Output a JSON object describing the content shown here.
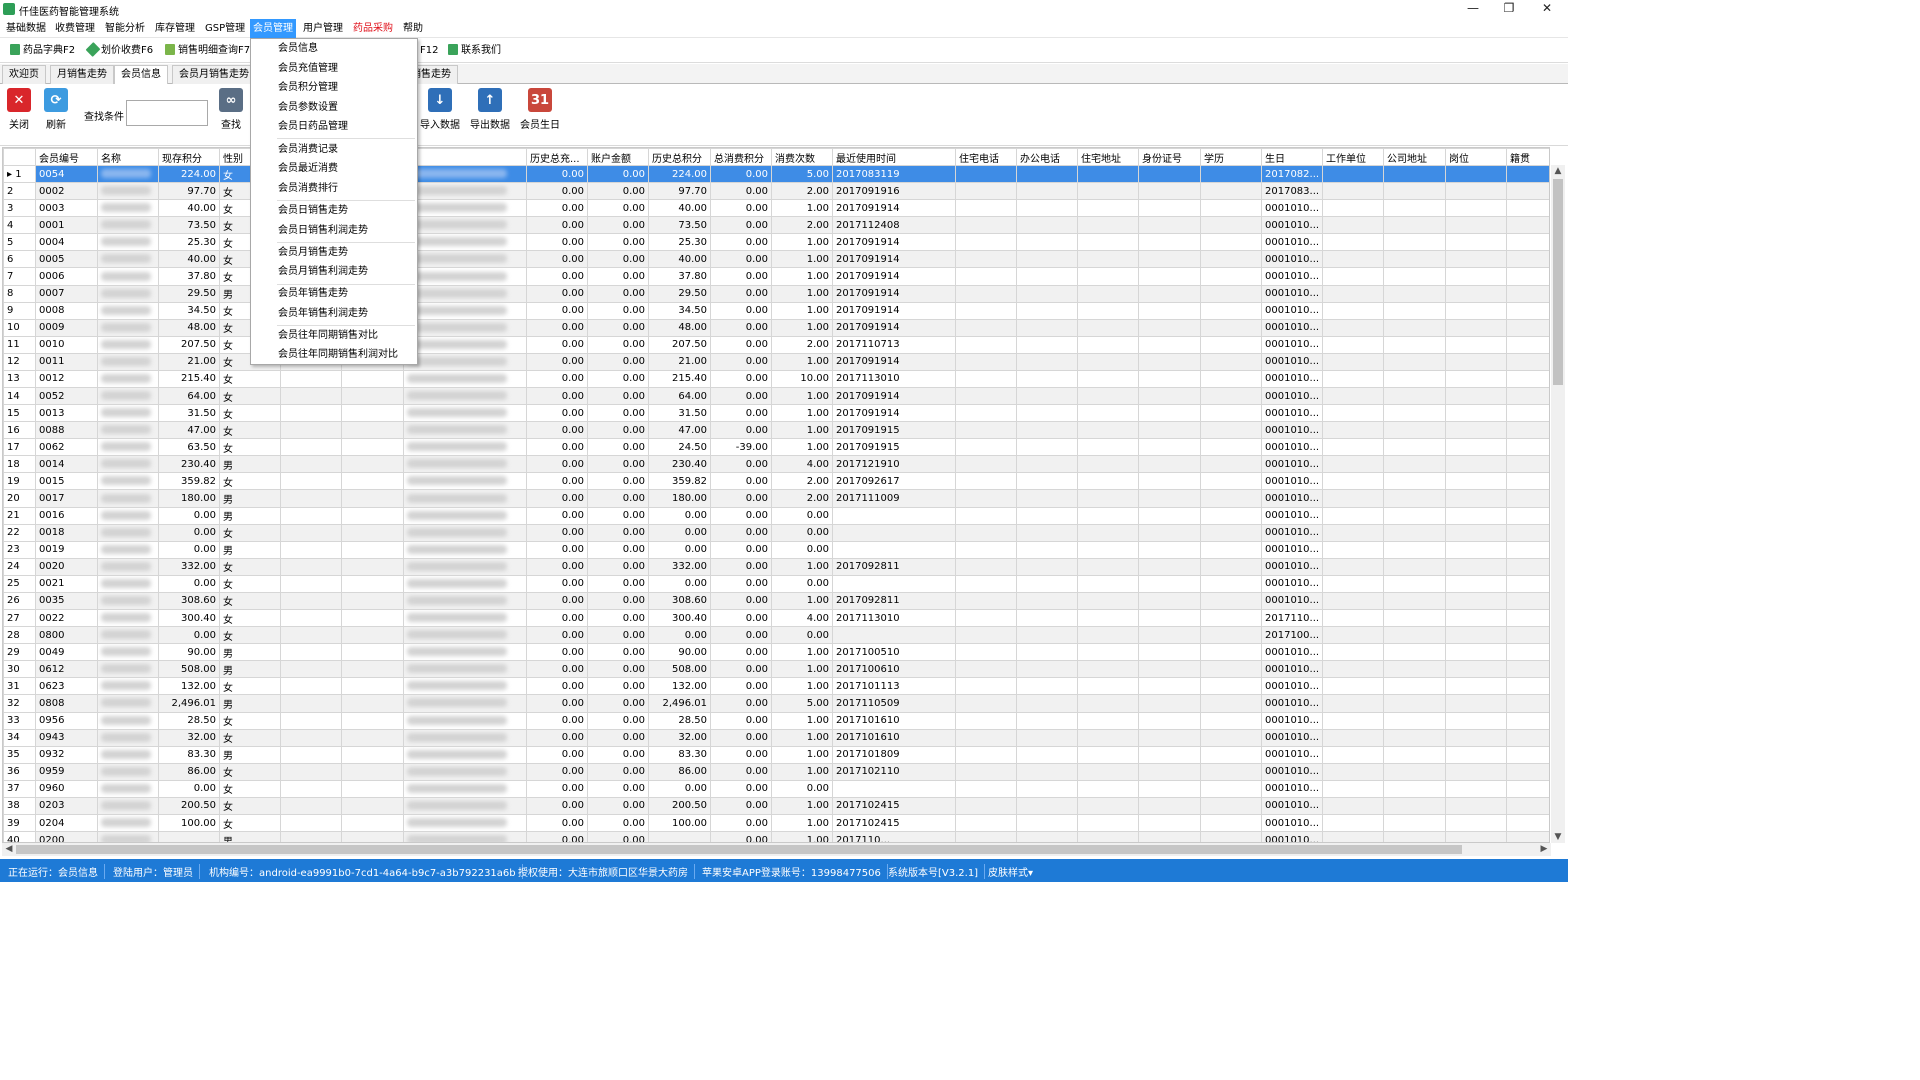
{
  "window": {
    "title": "仟佳医药智能管理系统",
    "min": "—",
    "restore": "❐",
    "close": "✕"
  },
  "menubar": [
    "基础数据",
    "收费管理",
    "智能分析",
    "库存管理",
    "GSP管理",
    "会员管理",
    "用户管理",
    "药品采购",
    "帮助"
  ],
  "quickbar": [
    {
      "label": "药品字典F2",
      "icon": "book-icon",
      "color": "#3aa35a"
    },
    {
      "label": "划价收费F6",
      "icon": "tag-icon",
      "color": "#3aa35a"
    },
    {
      "label": "销售明细查询F7",
      "icon": "document-icon",
      "color": "#7bb54a"
    },
    {
      "label": "F12",
      "icon": "",
      "color": ""
    },
    {
      "label": "联系我们",
      "icon": "contact-icon",
      "color": "#3aa35a"
    }
  ],
  "tabs": [
    "欢迎页",
    "月销售走势",
    "会员信息",
    "会员月销售走势",
    "销售走势"
  ],
  "toolbar": {
    "close": "关闭",
    "refresh": "刷新",
    "search_label": "查找条件",
    "search_value": "",
    "find": "查找",
    "import": "导入数据",
    "export": "导出数据",
    "birthday": "会员生日"
  },
  "columns": [
    "",
    "会员编号",
    "名称",
    "现存积分",
    "性别",
    "",
    "",
    "机",
    "历史总充...",
    "账户金额",
    "历史总积分",
    "总消费积分",
    "消费次数",
    "最近使用时间",
    "住宅电话",
    "办公电话",
    "住宅地址",
    "身份证号",
    "学历",
    "生日",
    "工作单位",
    "公司地址",
    "岗位",
    "籍贯"
  ],
  "rows": [
    [
      "▸ 1",
      "0054",
      "224.00",
      "女",
      "0.00",
      "0.00",
      "224.00",
      "0.00",
      "5.00",
      "2017083119",
      "2017082..."
    ],
    [
      "2",
      "0002",
      "97.70",
      "女",
      "0.00",
      "0.00",
      "97.70",
      "0.00",
      "2.00",
      "2017091916",
      "2017083..."
    ],
    [
      "3",
      "0003",
      "40.00",
      "女",
      "0.00",
      "0.00",
      "40.00",
      "0.00",
      "1.00",
      "2017091914",
      "0001010..."
    ],
    [
      "4",
      "0001",
      "73.50",
      "女",
      "0.00",
      "0.00",
      "73.50",
      "0.00",
      "2.00",
      "2017112408",
      "0001010..."
    ],
    [
      "5",
      "0004",
      "25.30",
      "女",
      "0.00",
      "0.00",
      "25.30",
      "0.00",
      "1.00",
      "2017091914",
      "0001010..."
    ],
    [
      "6",
      "0005",
      "40.00",
      "女",
      "0.00",
      "0.00",
      "40.00",
      "0.00",
      "1.00",
      "2017091914",
      "0001010..."
    ],
    [
      "7",
      "0006",
      "37.80",
      "女",
      "0.00",
      "0.00",
      "37.80",
      "0.00",
      "1.00",
      "2017091914",
      "0001010..."
    ],
    [
      "8",
      "0007",
      "29.50",
      "男",
      "0.00",
      "0.00",
      "29.50",
      "0.00",
      "1.00",
      "2017091914",
      "0001010..."
    ],
    [
      "9",
      "0008",
      "34.50",
      "女",
      "0.00",
      "0.00",
      "34.50",
      "0.00",
      "1.00",
      "2017091914",
      "0001010..."
    ],
    [
      "10",
      "0009",
      "48.00",
      "女",
      "0.00",
      "0.00",
      "48.00",
      "0.00",
      "1.00",
      "2017091914",
      "0001010..."
    ],
    [
      "11",
      "0010",
      "207.50",
      "女",
      "0.00",
      "0.00",
      "207.50",
      "0.00",
      "2.00",
      "2017110713",
      "0001010..."
    ],
    [
      "12",
      "0011",
      "21.00",
      "女",
      "0.00",
      "0.00",
      "21.00",
      "0.00",
      "1.00",
      "2017091914",
      "0001010..."
    ],
    [
      "13",
      "0012",
      "215.40",
      "女",
      "0.00",
      "0.00",
      "215.40",
      "0.00",
      "10.00",
      "2017113010",
      "0001010..."
    ],
    [
      "14",
      "0052",
      "64.00",
      "女",
      "0.00",
      "0.00",
      "64.00",
      "0.00",
      "1.00",
      "2017091914",
      "0001010..."
    ],
    [
      "15",
      "0013",
      "31.50",
      "女",
      "0.00",
      "0.00",
      "31.50",
      "0.00",
      "1.00",
      "2017091914",
      "0001010..."
    ],
    [
      "16",
      "0088",
      "47.00",
      "女",
      "0.00",
      "0.00",
      "47.00",
      "0.00",
      "1.00",
      "2017091915",
      "0001010..."
    ],
    [
      "17",
      "0062",
      "63.50",
      "女",
      "0.00",
      "0.00",
      "24.50",
      "-39.00",
      "1.00",
      "2017091915",
      "0001010..."
    ],
    [
      "18",
      "0014",
      "230.40",
      "男",
      "0.00",
      "0.00",
      "230.40",
      "0.00",
      "4.00",
      "2017121910",
      "0001010..."
    ],
    [
      "19",
      "0015",
      "359.82",
      "女",
      "0.00",
      "0.00",
      "359.82",
      "0.00",
      "2.00",
      "2017092617",
      "0001010..."
    ],
    [
      "20",
      "0017",
      "180.00",
      "男",
      "0.00",
      "0.00",
      "180.00",
      "0.00",
      "2.00",
      "2017111009",
      "0001010..."
    ],
    [
      "21",
      "0016",
      "0.00",
      "男",
      "0.00",
      "0.00",
      "0.00",
      "0.00",
      "0.00",
      "",
      "0001010..."
    ],
    [
      "22",
      "0018",
      "0.00",
      "女",
      "0.00",
      "0.00",
      "0.00",
      "0.00",
      "0.00",
      "",
      "0001010..."
    ],
    [
      "23",
      "0019",
      "0.00",
      "男",
      "0.00",
      "0.00",
      "0.00",
      "0.00",
      "0.00",
      "",
      "0001010..."
    ],
    [
      "24",
      "0020",
      "332.00",
      "女",
      "0.00",
      "0.00",
      "332.00",
      "0.00",
      "1.00",
      "2017092811",
      "0001010..."
    ],
    [
      "25",
      "0021",
      "0.00",
      "女",
      "0.00",
      "0.00",
      "0.00",
      "0.00",
      "0.00",
      "",
      "0001010..."
    ],
    [
      "26",
      "0035",
      "308.60",
      "女",
      "0.00",
      "0.00",
      "308.60",
      "0.00",
      "1.00",
      "2017092811",
      "0001010..."
    ],
    [
      "27",
      "0022",
      "300.40",
      "女",
      "0.00",
      "0.00",
      "300.40",
      "0.00",
      "4.00",
      "2017113010",
      "2017110..."
    ],
    [
      "28",
      "0800",
      "0.00",
      "女",
      "0.00",
      "0.00",
      "0.00",
      "0.00",
      "0.00",
      "",
      "2017100..."
    ],
    [
      "29",
      "0049",
      "90.00",
      "男",
      "0.00",
      "0.00",
      "90.00",
      "0.00",
      "1.00",
      "2017100510",
      "0001010..."
    ],
    [
      "30",
      "0612",
      "508.00",
      "男",
      "0.00",
      "0.00",
      "508.00",
      "0.00",
      "1.00",
      "2017100610",
      "0001010..."
    ],
    [
      "31",
      "0623",
      "132.00",
      "女",
      "0.00",
      "0.00",
      "132.00",
      "0.00",
      "1.00",
      "2017101113",
      "0001010..."
    ],
    [
      "32",
      "0808",
      "2,496.01",
      "男",
      "0.00",
      "0.00",
      "2,496.01",
      "0.00",
      "5.00",
      "2017110509",
      "0001010..."
    ],
    [
      "33",
      "0956",
      "28.50",
      "女",
      "0.00",
      "0.00",
      "28.50",
      "0.00",
      "1.00",
      "2017101610",
      "0001010..."
    ],
    [
      "34",
      "0943",
      "32.00",
      "女",
      "0.00",
      "0.00",
      "32.00",
      "0.00",
      "1.00",
      "2017101610",
      "0001010..."
    ],
    [
      "35",
      "0932",
      "83.30",
      "男",
      "0.00",
      "0.00",
      "83.30",
      "0.00",
      "1.00",
      "2017101809",
      "0001010..."
    ],
    [
      "36",
      "0959",
      "86.00",
      "女",
      "0.00",
      "0.00",
      "86.00",
      "0.00",
      "1.00",
      "2017102110",
      "0001010..."
    ],
    [
      "37",
      "0960",
      "0.00",
      "女",
      "0.00",
      "0.00",
      "0.00",
      "0.00",
      "0.00",
      "",
      "0001010..."
    ],
    [
      "38",
      "0203",
      "200.50",
      "女",
      "0.00",
      "0.00",
      "200.50",
      "0.00",
      "1.00",
      "2017102415",
      "0001010..."
    ],
    [
      "39",
      "0204",
      "100.00",
      "女",
      "0.00",
      "0.00",
      "100.00",
      "0.00",
      "1.00",
      "2017102415",
      "0001010..."
    ],
    [
      "40",
      "0200",
      "",
      "男",
      "0.00",
      "0.00",
      "",
      "0.00",
      "1.00",
      "2017110...",
      "0001010..."
    ]
  ],
  "dropdown": {
    "groups": [
      [
        "会员信息",
        "会员充值管理",
        "会员积分管理",
        "会员参数设置",
        "会员日药品管理"
      ],
      [
        "会员消费记录",
        "会员最近消费",
        "会员消费排行"
      ],
      [
        "会员日销售走势",
        "会员日销售利润走势"
      ],
      [
        "会员月销售走势",
        "会员月销售利润走势"
      ],
      [
        "会员年销售走势",
        "会员年销售利润走势"
      ],
      [
        "会员往年同期销售对比",
        "会员往年同期销售利润对比"
      ]
    ]
  },
  "status": [
    "正在运行：会员信息",
    "登陆用户：管理员",
    "机构编号：android-ea9991b0-7cd1-4a64-b9c7-a3b792231a6b",
    "授权使用：大连市旅顺口区华景大药房",
    "苹果安卓APP登录账号：13998477506",
    "系统版本号[V3.2.1]",
    "皮肤样式▾"
  ]
}
